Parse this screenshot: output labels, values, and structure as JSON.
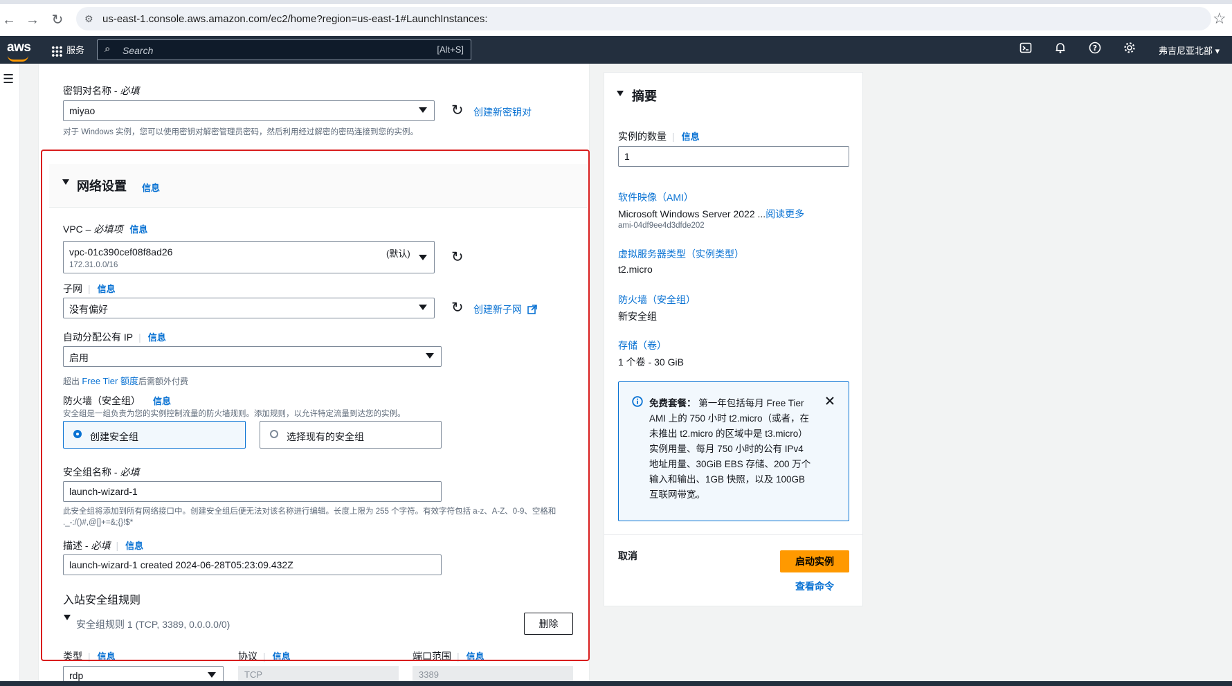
{
  "browser": {
    "url": "us-east-1.console.aws.amazon.com/ec2/home?region=us-east-1#LaunchInstances:"
  },
  "awsnav": {
    "logo": "aws",
    "services": "服务",
    "search_placeholder": "Search",
    "search_shortcut": "[Alt+S]",
    "region": "弗吉尼亚北部 ▾"
  },
  "keypair": {
    "label": "密钥对名称 - ",
    "label_req": "必填",
    "value": "miyao",
    "create_link": "创建新密钥对",
    "help": "对于 Windows 实例，您可以使用密钥对解密管理员密码，然后利用经过解密的密码连接到您的实例。"
  },
  "network": {
    "title": "网络设置",
    "info": "信息",
    "vpc_label": "VPC – ",
    "vpc_req": "必填项",
    "vpc_value": "vpc-01c390cef08f8ad26",
    "vpc_cidr": "172.31.0.0/16",
    "vpc_default": "(默认)",
    "subnet_label": "子网",
    "subnet_value": "没有偏好",
    "create_subnet": "创建新子网",
    "autoip_label": "自动分配公有 IP",
    "autoip_value": "启用",
    "autoip_help_pre": "超出 ",
    "autoip_help_link": "Free Tier 额度",
    "autoip_help_post": "后需额外付费",
    "firewall_label": "防火墙（安全组）",
    "firewall_help": "安全组是一组负责为您的实例控制流量的防火墙规则。添加规则，以允许特定流量到达您的实例。",
    "opt_create": "创建安全组",
    "opt_existing": "选择现有的安全组",
    "sg_name_label": "安全组名称 - ",
    "sg_name_req": "必填",
    "sg_name_value": "launch-wizard-1",
    "sg_name_help": "此安全组将添加到所有网络接口中。创建安全组后便无法对该名称进行编辑。长度上限为 255 个字符。有效字符包括 a-z、A-Z、0-9、空格和 ._-:/()#,@[]+=&;{}!$*",
    "desc_label": "描述 - ",
    "desc_req": "必填",
    "desc_value": "launch-wizard-1 created 2024-06-28T05:23:09.432Z",
    "inbound_title": "入站安全组规则",
    "rule_title": "安全组规则 1 (TCP, 3389, 0.0.0.0/0)",
    "delete_btn": "删除",
    "col_type": "类型",
    "col_protocol": "协议",
    "col_port": "端口范围",
    "type_value": "rdp",
    "protocol_value": "TCP",
    "port_value": "3389"
  },
  "summary": {
    "title": "摘要",
    "count_label": "实例的数量",
    "info": "信息",
    "count_value": "1",
    "ami_label": "软件映像（AMI）",
    "ami_value": "Microsoft Windows Server 2022 ...",
    "ami_more": "阅读更多",
    "ami_id": "ami-04df9ee4d3dfde202",
    "type_label": "虚拟服务器类型（实例类型）",
    "type_value": "t2.micro",
    "fw_label": "防火墙（安全组）",
    "fw_value": "新安全组",
    "storage_label": "存储（卷）",
    "storage_value": "1 个卷 - 30 GiB",
    "free_bold": "免费套餐：",
    "free_text": "第一年包括每月 Free Tier AMI 上的 750 小时 t2.micro（或者，在未推出 t2.micro 的区域中是 t3.micro）实例用量、每月 750 小时的公有 IPv4 地址用量、30GiB EBS 存储、200 万个输入和输出、1GB 快照，以及 100GB 互联网带宽。",
    "cancel": "取消",
    "launch": "启动实例",
    "view_cmd": "查看命令"
  }
}
